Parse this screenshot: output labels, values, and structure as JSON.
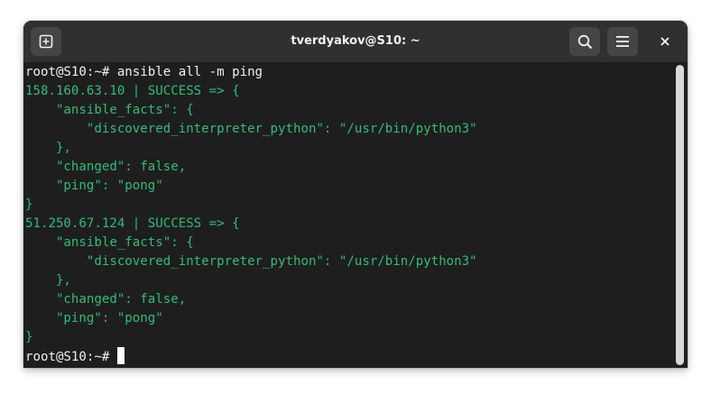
{
  "window": {
    "title": "tverdyakov@S10: ~"
  },
  "icons": {
    "new_tab": "new-tab-icon",
    "search": "search-icon",
    "menu": "hamburger-menu-icon",
    "close": "close-icon"
  },
  "colors": {
    "background": "#1e1e1e",
    "titlebar": "#303030",
    "output_green": "#2ebd76",
    "prompt_white": "#f0f0f0"
  },
  "terminal": {
    "lines": [
      "root@S10:~# ansible all -m ping",
      "158.160.63.10 | SUCCESS => {",
      "    \"ansible_facts\": {",
      "        \"discovered_interpreter_python\": \"/usr/bin/python3\"",
      "    },",
      "    \"changed\": false,",
      "    \"ping\": \"pong\"",
      "}",
      "51.250.67.124 | SUCCESS => {",
      "    \"ansible_facts\": {",
      "        \"discovered_interpreter_python\": \"/usr/bin/python3\"",
      "    },",
      "    \"changed\": false,",
      "    \"ping\": \"pong\"",
      "}"
    ],
    "prompt": "root@S10:~# "
  }
}
